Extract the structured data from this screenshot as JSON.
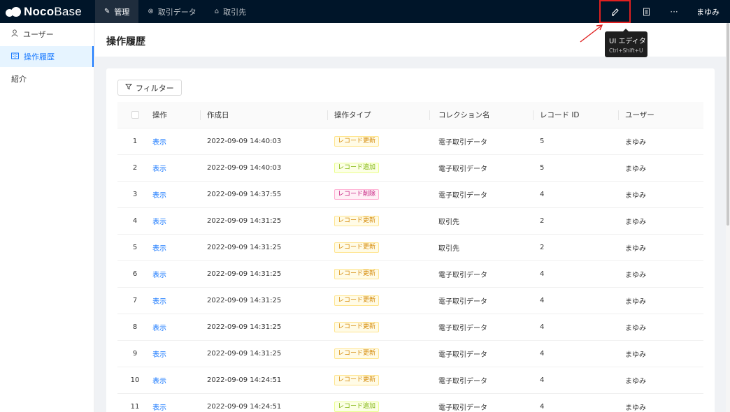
{
  "app": {
    "logo_bold": "Noco",
    "logo_light": "Base"
  },
  "topnav": [
    {
      "label": "管理",
      "icon": "pencil-icon",
      "active": true
    },
    {
      "label": "取引データ",
      "icon": "circle-x-icon",
      "active": false
    },
    {
      "label": "取引先",
      "icon": "home-icon",
      "active": false
    }
  ],
  "top_right": {
    "ui_editor_icon": "highlighter-icon",
    "menu_icon": "book-icon",
    "more_label": "···",
    "user_name": "まゆみ"
  },
  "tooltip": {
    "title": "UI エディタ",
    "shortcut": "Ctrl+Shift+U"
  },
  "sidebar": {
    "items": [
      {
        "label": "ユーザー",
        "icon": "user-icon",
        "active": false
      },
      {
        "label": "操作履歴",
        "icon": "book-open-icon",
        "active": true
      },
      {
        "label": "紹介",
        "icon": "",
        "active": false
      }
    ]
  },
  "page": {
    "title": "操作履歴"
  },
  "filter": {
    "label": "フィルター"
  },
  "table": {
    "headers": {
      "op": "操作",
      "created": "作成日",
      "type": "操作タイプ",
      "collection": "コレクション名",
      "record_id": "レコード ID",
      "user": "ユーザー"
    },
    "rows": [
      {
        "idx": "1",
        "op": "表示",
        "date": "2022-09-09 14:40:03",
        "type": "レコード更新",
        "kind": "update",
        "collection": "電子取引データ",
        "record": "5",
        "user": "まゆみ"
      },
      {
        "idx": "2",
        "op": "表示",
        "date": "2022-09-09 14:40:03",
        "type": "レコード追加",
        "kind": "create",
        "collection": "電子取引データ",
        "record": "5",
        "user": "まゆみ"
      },
      {
        "idx": "3",
        "op": "表示",
        "date": "2022-09-09 14:37:55",
        "type": "レコード削除",
        "kind": "delete",
        "collection": "電子取引データ",
        "record": "4",
        "user": "まゆみ"
      },
      {
        "idx": "4",
        "op": "表示",
        "date": "2022-09-09 14:31:25",
        "type": "レコード更新",
        "kind": "update",
        "collection": "取引先",
        "record": "2",
        "user": "まゆみ"
      },
      {
        "idx": "5",
        "op": "表示",
        "date": "2022-09-09 14:31:25",
        "type": "レコード更新",
        "kind": "update",
        "collection": "取引先",
        "record": "2",
        "user": "まゆみ"
      },
      {
        "idx": "6",
        "op": "表示",
        "date": "2022-09-09 14:31:25",
        "type": "レコード更新",
        "kind": "update",
        "collection": "電子取引データ",
        "record": "4",
        "user": "まゆみ"
      },
      {
        "idx": "7",
        "op": "表示",
        "date": "2022-09-09 14:31:25",
        "type": "レコード更新",
        "kind": "update",
        "collection": "電子取引データ",
        "record": "4",
        "user": "まゆみ"
      },
      {
        "idx": "8",
        "op": "表示",
        "date": "2022-09-09 14:31:25",
        "type": "レコード更新",
        "kind": "update",
        "collection": "電子取引データ",
        "record": "4",
        "user": "まゆみ"
      },
      {
        "idx": "9",
        "op": "表示",
        "date": "2022-09-09 14:31:25",
        "type": "レコード更新",
        "kind": "update",
        "collection": "電子取引データ",
        "record": "4",
        "user": "まゆみ"
      },
      {
        "idx": "10",
        "op": "表示",
        "date": "2022-09-09 14:24:51",
        "type": "レコード更新",
        "kind": "update",
        "collection": "電子取引データ",
        "record": "4",
        "user": "まゆみ"
      },
      {
        "idx": "11",
        "op": "表示",
        "date": "2022-09-09 14:24:51",
        "type": "レコード追加",
        "kind": "create",
        "collection": "電子取引データ",
        "record": "4",
        "user": "まゆみ"
      }
    ]
  },
  "colors": {
    "topbar": "#001529",
    "accent": "#1677ff",
    "annotation": "#e02020"
  }
}
